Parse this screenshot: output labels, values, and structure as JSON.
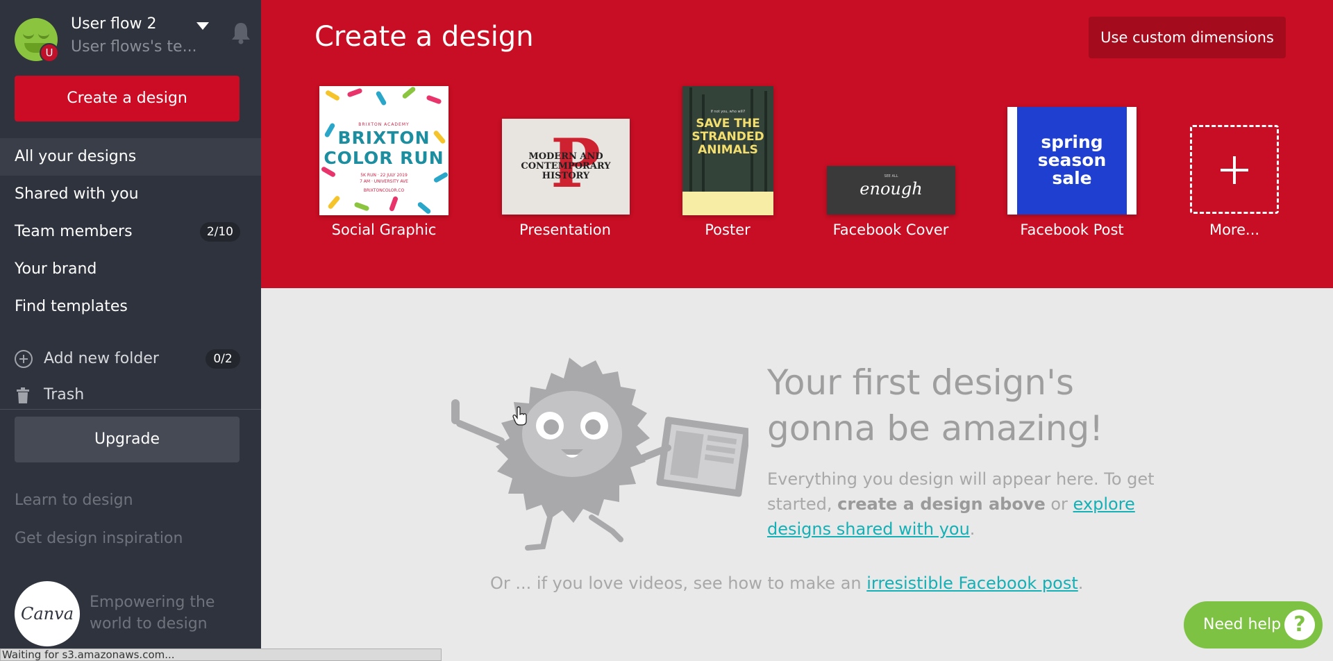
{
  "user": {
    "name": "User flow 2",
    "team": "User flows's te...",
    "badge": "U"
  },
  "sidebar": {
    "create_label": "Create a design",
    "nav": [
      {
        "label": "All your designs"
      },
      {
        "label": "Shared with you"
      },
      {
        "label": "Team members",
        "count": "2/10"
      },
      {
        "label": "Your brand"
      },
      {
        "label": "Find templates"
      }
    ],
    "folder": {
      "label": "Add new folder",
      "count": "0/2"
    },
    "trash_label": "Trash",
    "upgrade_label": "Upgrade",
    "learn_label": "Learn to design",
    "inspiration_label": "Get design inspiration",
    "logo_text": "Canva",
    "tagline_1": "Empowering the",
    "tagline_2": "world to design"
  },
  "header": {
    "title": "Create a design",
    "custom_label": "Use custom dimensions",
    "templates": [
      {
        "label": "Social Graphic"
      },
      {
        "label": "Presentation"
      },
      {
        "label": "Poster"
      },
      {
        "label": "Facebook Cover"
      },
      {
        "label": "Facebook Post"
      },
      {
        "label": "More..."
      }
    ],
    "thumbs": {
      "social": {
        "top": "BRIXTON ACADEMY",
        "line1": "BRIXTON",
        "line2": "COLOR RUN",
        "meta1": "5K RUN · 22 JULY 2019",
        "meta2": "7 AM · UNIVERSITY AVE",
        "meta3": "BRIXTONCOLOR.CO"
      },
      "presentation": {
        "line1": "MODERN AND",
        "line2": "CONTEMPORARY",
        "line3": "HISTORY",
        "letter": "P"
      },
      "poster": {
        "pre": "If not you, who will?",
        "line1": "SAVE THE",
        "line2": "STRANDED",
        "line3": "ANIMALS"
      },
      "fbcover": {
        "pre": "SEE ALL",
        "text": "enough"
      },
      "fbpost": {
        "line1": "spring",
        "line2": "season",
        "line3": "sale"
      }
    }
  },
  "empty_state": {
    "headline_1": "Your first design's",
    "headline_2": "gonna be amazing!",
    "body_1": "Everything you design will appear here. To get started, ",
    "body_bold": "create a design above",
    "body_2": " or ",
    "body_link": "explore designs shared with you",
    "body_3": ".",
    "video_pre": "Or ... if you love videos, see how to make an ",
    "video_link": "irresistible Facebook post",
    "video_post": "."
  },
  "help": {
    "label": "Need help",
    "icon": "?"
  },
  "status_bar": "Waiting for s3.amazonaws.com...",
  "colors": {
    "brand_red": "#c70e24",
    "sidebar": "#2f333d",
    "link": "#14b0b5",
    "help": "#7dc242"
  }
}
